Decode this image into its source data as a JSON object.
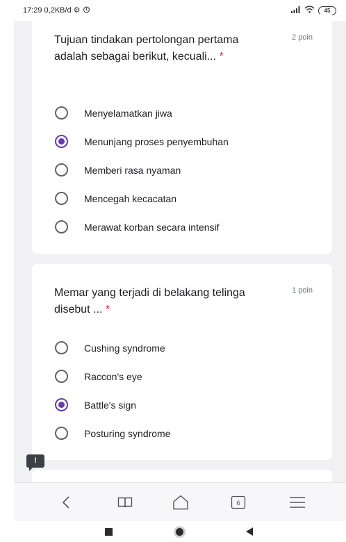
{
  "status_bar": {
    "time": "17:29",
    "speed": "0,2KB/d",
    "battery": "45"
  },
  "questions": [
    {
      "title": "Tujuan tindakan pertolongan pertama adalah sebagai berikut, kecuali...",
      "required_mark": "*",
      "points": "2 poin",
      "options": [
        {
          "label": "Menyelamatkan jiwa",
          "checked": false
        },
        {
          "label": "Menunjang proses penyembuhan",
          "checked": true
        },
        {
          "label": "Memberi rasa nyaman",
          "checked": false
        },
        {
          "label": "Mencegah kecacatan",
          "checked": false
        },
        {
          "label": "Merawat korban secara intensif",
          "checked": false
        }
      ]
    },
    {
      "title": "Memar yang terjadi di belakang telinga disebut ...",
      "required_mark": "*",
      "points": "1 poin",
      "options": [
        {
          "label": "Cushing syndrome",
          "checked": false
        },
        {
          "label": "Raccon's eye",
          "checked": false
        },
        {
          "label": "Battle's sign",
          "checked": true
        },
        {
          "label": "Posturing syndrome",
          "checked": false
        }
      ]
    }
  ],
  "feedback_icon": "!",
  "nav": {
    "tab_count": "6",
    "icons": [
      "back-icon",
      "bookmarks-icon",
      "home-icon",
      "tabs-icon",
      "menu-icon"
    ]
  },
  "colors": {
    "accent": "#673ab7",
    "required": "#d93025",
    "background": "#f1f1f4"
  }
}
